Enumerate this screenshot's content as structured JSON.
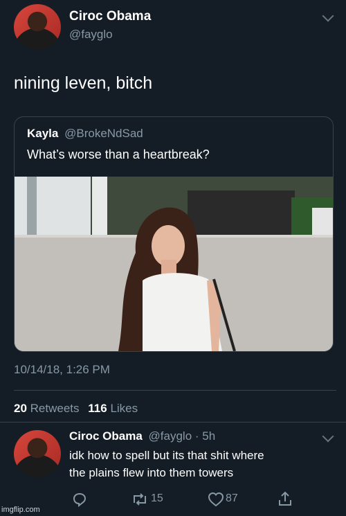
{
  "tweet": {
    "author_name": "Ciroc Obama",
    "author_handle": "@fayglo",
    "text": "nining leven, bitch",
    "timestamp": "10/14/18, 1:26 PM",
    "retweets_count": "20",
    "retweets_label": "Retweets",
    "likes_count": "116",
    "likes_label": "Likes"
  },
  "quoted_tweet": {
    "author_name": "Kayla",
    "author_handle": "@BrokeNdSad",
    "text": "What’s worse than a heartbreak?"
  },
  "reply": {
    "author_name": "Ciroc Obama",
    "author_handle": "@fayglo",
    "time": "· 5h",
    "text_line1": "idk how to spell but its that shit where",
    "text_line2": "the plains flew into them towers",
    "retweet_count": "15",
    "like_count": "87"
  },
  "watermark": "imgflip.com",
  "colors": {
    "background": "#141d26",
    "secondary_text": "#8899a6",
    "divider": "#38444d"
  }
}
